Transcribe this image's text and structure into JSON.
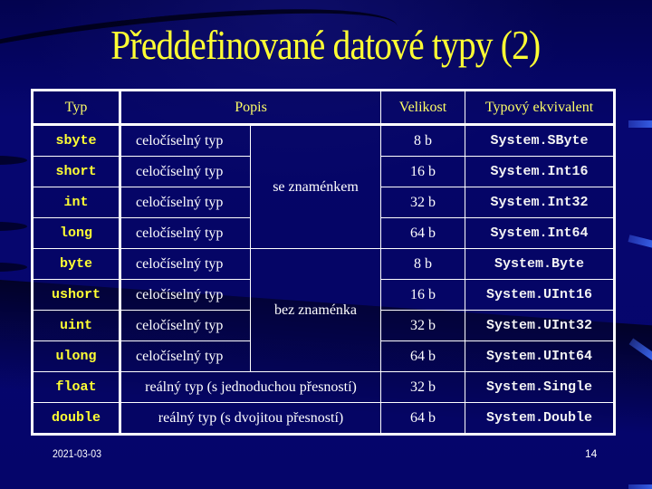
{
  "slide": {
    "title": "Předdefinované datové typy (2)",
    "date": "2021-03-03",
    "page_number": "14"
  },
  "table": {
    "headers": {
      "type": "Typ",
      "description": "Popis",
      "size": "Velikost",
      "equivalent": "Typový ekvivalent"
    },
    "groups": {
      "signed": "se znaménkem",
      "unsigned": "bez znaménka"
    },
    "rows": [
      {
        "type": "sbyte",
        "description": "celočíselný typ",
        "size": "8 b",
        "equivalent": "System.SByte"
      },
      {
        "type": "short",
        "description": "celočíselný typ",
        "size": "16 b",
        "equivalent": "System.Int16"
      },
      {
        "type": "int",
        "description": "celočíselný typ",
        "size": "32 b",
        "equivalent": "System.Int32"
      },
      {
        "type": "long",
        "description": "celočíselný typ",
        "size": "64 b",
        "equivalent": "System.Int64"
      },
      {
        "type": "byte",
        "description": "celočíselný typ",
        "size": "8 b",
        "equivalent": "System.Byte"
      },
      {
        "type": "ushort",
        "description": "celočíselný typ",
        "size": "16 b",
        "equivalent": "System.UInt16"
      },
      {
        "type": "uint",
        "description": "celočíselný typ",
        "size": "32 b",
        "equivalent": "System.UInt32"
      },
      {
        "type": "ulong",
        "description": "celočíselný typ",
        "size": "64 b",
        "equivalent": "System.UInt64"
      },
      {
        "type": "float",
        "description": "reálný typ (s jednoduchou přesností)",
        "size": "32 b",
        "equivalent": "System.Single"
      },
      {
        "type": "double",
        "description": "reálný typ (s dvojitou přesností)",
        "size": "64 b",
        "equivalent": "System.Double"
      }
    ]
  },
  "colors": {
    "background": "#05056e",
    "title": "#ffff33",
    "header_text": "#ffff66",
    "type_text": "#ffff33",
    "body_text": "#ffffff",
    "border": "#ffffff"
  }
}
